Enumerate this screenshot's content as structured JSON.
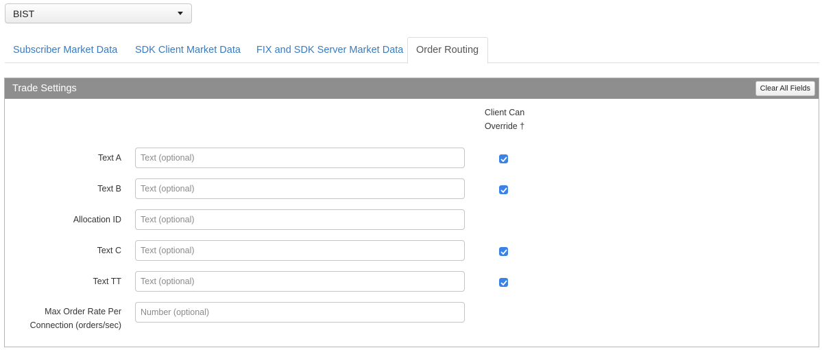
{
  "exchange_select": {
    "value": "BIST"
  },
  "tabs": [
    {
      "label": "Subscriber Market Data",
      "active": false
    },
    {
      "label": "SDK Client Market Data",
      "active": false
    },
    {
      "label": "FIX and SDK Server Market Data",
      "active": false
    },
    {
      "label": "Order Routing",
      "active": true
    }
  ],
  "panel": {
    "title": "Trade Settings",
    "clear_button": "Clear All Fields",
    "override_header_line1": "Client Can",
    "override_header_line2": "Override †",
    "rows": [
      {
        "label": "Text A",
        "placeholder": "Text (optional)",
        "value": "",
        "override_checked": true
      },
      {
        "label": "Text B",
        "placeholder": "Text (optional)",
        "value": "",
        "override_checked": true
      },
      {
        "label": "Allocation ID",
        "placeholder": "Text (optional)",
        "value": "",
        "override_checked": null
      },
      {
        "label": "Text C",
        "placeholder": "Text (optional)",
        "value": "",
        "override_checked": true
      },
      {
        "label": "Text TT",
        "placeholder": "Text (optional)",
        "value": "",
        "override_checked": true
      },
      {
        "label_line1": "Max Order Rate Per",
        "label_line2": "Connection (orders/sec)",
        "placeholder": "Number (optional)",
        "value": "",
        "override_checked": null
      }
    ]
  },
  "colors": {
    "accent": "#3b82e6",
    "tab_link": "#3a7bbf",
    "panel_header": "#8e8e8e"
  }
}
